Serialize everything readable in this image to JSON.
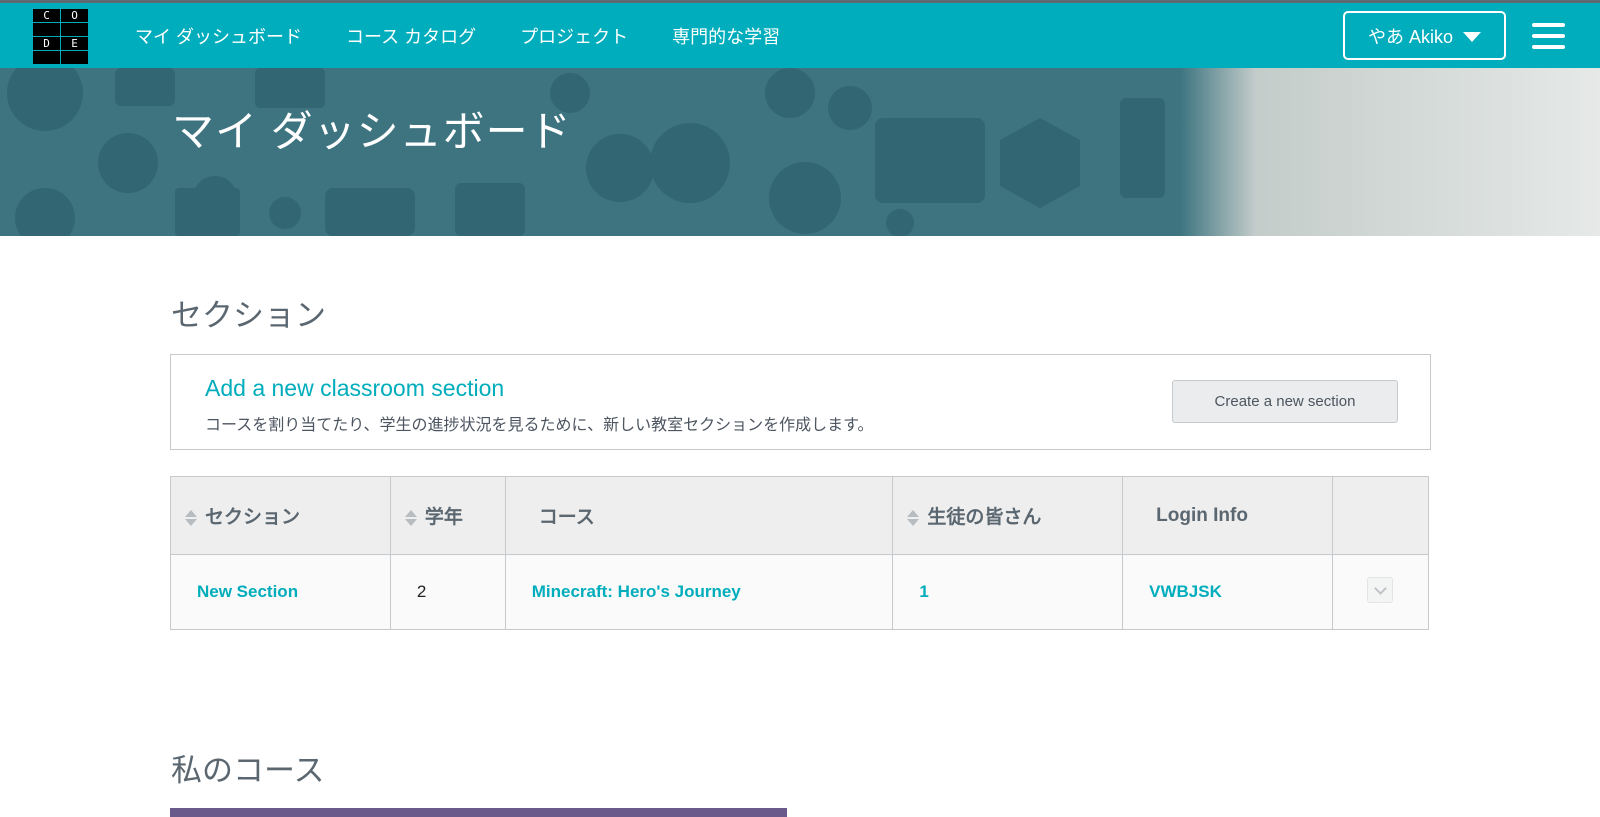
{
  "nav": {
    "logo_letters": [
      "C",
      "O",
      "D",
      "E"
    ],
    "links": [
      "マイ ダッシュボード",
      "コース カタログ",
      "プロジェクト",
      "専門的な学習"
    ],
    "user_label": "やあ Akiko"
  },
  "hero": {
    "title": "マイ ダッシュボード"
  },
  "sections": {
    "heading": "セクション",
    "add_box": {
      "title": "Add a new classroom section",
      "description": "コースを割り当てたり、学生の進捗状況を見るために、新しい教室セクションを作成します。",
      "button_label": "Create a new section"
    },
    "table": {
      "headers": [
        "セクション",
        "学年",
        "コース",
        "生徒の皆さん",
        "Login Info",
        ""
      ],
      "rows": [
        {
          "section": "New Section",
          "grade": "2",
          "course": "Minecraft: Hero's Journey",
          "students": "1",
          "login": "VWBJSK"
        }
      ]
    }
  },
  "courses": {
    "heading": "私のコース"
  },
  "colors": {
    "accent": "#00adbc",
    "hero_bg": "#3d7480",
    "text": "#4d5560"
  }
}
